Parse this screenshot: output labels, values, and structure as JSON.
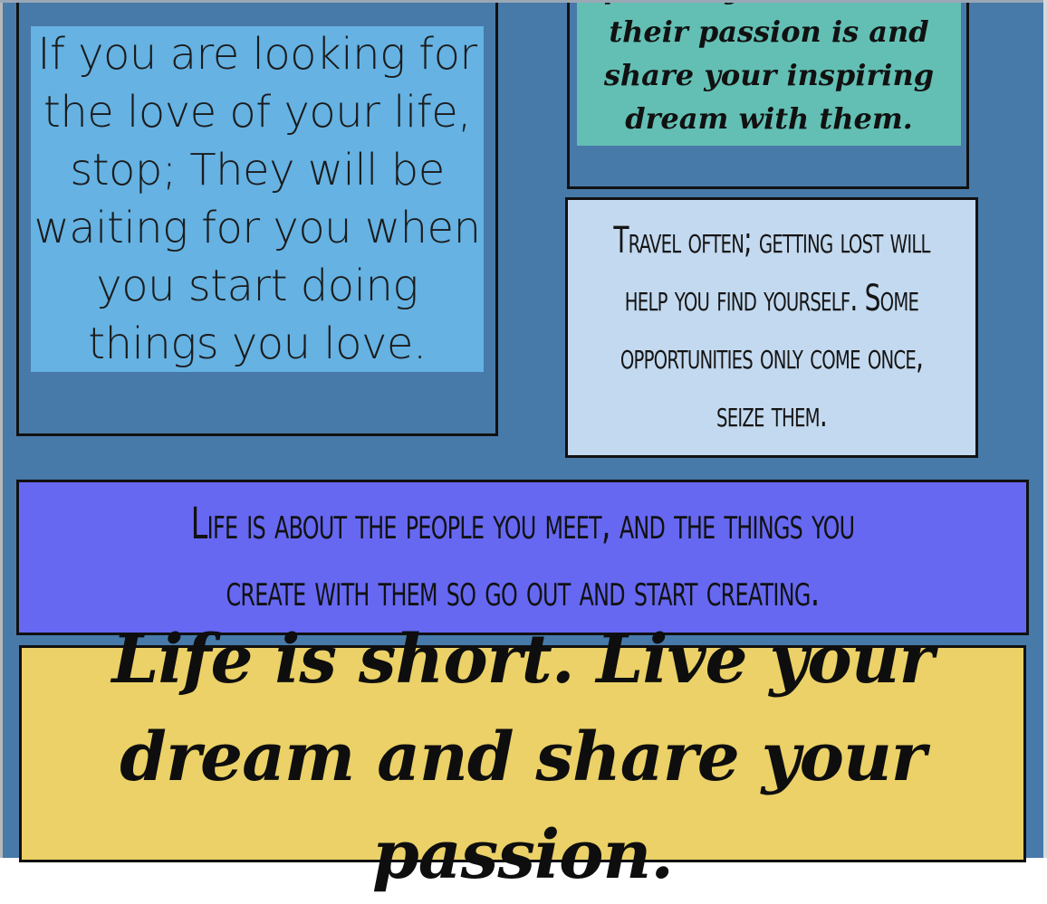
{
  "cards": {
    "left": {
      "text": "If you are looking for the love of your life, stop; They will be waiting for you when you start doing things you love."
    },
    "top_right": {
      "text": "person you see what their passion is and share your inspiring dream with them."
    },
    "travel": {
      "text": "Travel often; getting lost will help you find yourself. Some opportunities only come once, seize them."
    },
    "people": {
      "text": "Life is about the people you meet, and the things you create with them so go out and start creating."
    },
    "yellow": {
      "text": "Life is short. Live your dream and share your passion."
    }
  },
  "colors": {
    "background": "#4779a9",
    "left_inner": "#65b2e3",
    "top_right_inner": "#63bfb4",
    "travel": "#c3d9ef",
    "people": "#6668f2",
    "yellow": "#ebd167",
    "border": "#111111"
  }
}
